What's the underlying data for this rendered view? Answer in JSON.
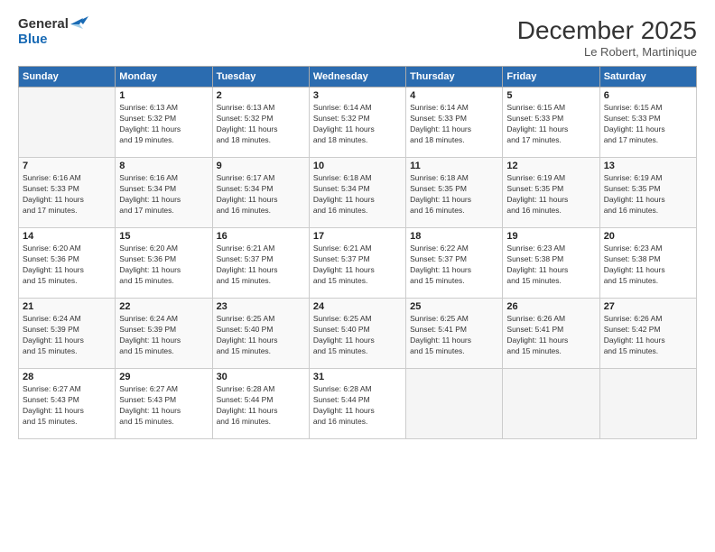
{
  "header": {
    "logo_line1": "General",
    "logo_line2": "Blue",
    "month_title": "December 2025",
    "subtitle": "Le Robert, Martinique"
  },
  "days_of_week": [
    "Sunday",
    "Monday",
    "Tuesday",
    "Wednesday",
    "Thursday",
    "Friday",
    "Saturday"
  ],
  "weeks": [
    [
      {
        "day": "",
        "info": ""
      },
      {
        "day": "1",
        "info": "Sunrise: 6:13 AM\nSunset: 5:32 PM\nDaylight: 11 hours\nand 19 minutes."
      },
      {
        "day": "2",
        "info": "Sunrise: 6:13 AM\nSunset: 5:32 PM\nDaylight: 11 hours\nand 18 minutes."
      },
      {
        "day": "3",
        "info": "Sunrise: 6:14 AM\nSunset: 5:32 PM\nDaylight: 11 hours\nand 18 minutes."
      },
      {
        "day": "4",
        "info": "Sunrise: 6:14 AM\nSunset: 5:33 PM\nDaylight: 11 hours\nand 18 minutes."
      },
      {
        "day": "5",
        "info": "Sunrise: 6:15 AM\nSunset: 5:33 PM\nDaylight: 11 hours\nand 17 minutes."
      },
      {
        "day": "6",
        "info": "Sunrise: 6:15 AM\nSunset: 5:33 PM\nDaylight: 11 hours\nand 17 minutes."
      }
    ],
    [
      {
        "day": "7",
        "info": "Sunrise: 6:16 AM\nSunset: 5:33 PM\nDaylight: 11 hours\nand 17 minutes."
      },
      {
        "day": "8",
        "info": "Sunrise: 6:16 AM\nSunset: 5:34 PM\nDaylight: 11 hours\nand 17 minutes."
      },
      {
        "day": "9",
        "info": "Sunrise: 6:17 AM\nSunset: 5:34 PM\nDaylight: 11 hours\nand 16 minutes."
      },
      {
        "day": "10",
        "info": "Sunrise: 6:18 AM\nSunset: 5:34 PM\nDaylight: 11 hours\nand 16 minutes."
      },
      {
        "day": "11",
        "info": "Sunrise: 6:18 AM\nSunset: 5:35 PM\nDaylight: 11 hours\nand 16 minutes."
      },
      {
        "day": "12",
        "info": "Sunrise: 6:19 AM\nSunset: 5:35 PM\nDaylight: 11 hours\nand 16 minutes."
      },
      {
        "day": "13",
        "info": "Sunrise: 6:19 AM\nSunset: 5:35 PM\nDaylight: 11 hours\nand 16 minutes."
      }
    ],
    [
      {
        "day": "14",
        "info": "Sunrise: 6:20 AM\nSunset: 5:36 PM\nDaylight: 11 hours\nand 15 minutes."
      },
      {
        "day": "15",
        "info": "Sunrise: 6:20 AM\nSunset: 5:36 PM\nDaylight: 11 hours\nand 15 minutes."
      },
      {
        "day": "16",
        "info": "Sunrise: 6:21 AM\nSunset: 5:37 PM\nDaylight: 11 hours\nand 15 minutes."
      },
      {
        "day": "17",
        "info": "Sunrise: 6:21 AM\nSunset: 5:37 PM\nDaylight: 11 hours\nand 15 minutes."
      },
      {
        "day": "18",
        "info": "Sunrise: 6:22 AM\nSunset: 5:37 PM\nDaylight: 11 hours\nand 15 minutes."
      },
      {
        "day": "19",
        "info": "Sunrise: 6:23 AM\nSunset: 5:38 PM\nDaylight: 11 hours\nand 15 minutes."
      },
      {
        "day": "20",
        "info": "Sunrise: 6:23 AM\nSunset: 5:38 PM\nDaylight: 11 hours\nand 15 minutes."
      }
    ],
    [
      {
        "day": "21",
        "info": "Sunrise: 6:24 AM\nSunset: 5:39 PM\nDaylight: 11 hours\nand 15 minutes."
      },
      {
        "day": "22",
        "info": "Sunrise: 6:24 AM\nSunset: 5:39 PM\nDaylight: 11 hours\nand 15 minutes."
      },
      {
        "day": "23",
        "info": "Sunrise: 6:25 AM\nSunset: 5:40 PM\nDaylight: 11 hours\nand 15 minutes."
      },
      {
        "day": "24",
        "info": "Sunrise: 6:25 AM\nSunset: 5:40 PM\nDaylight: 11 hours\nand 15 minutes."
      },
      {
        "day": "25",
        "info": "Sunrise: 6:25 AM\nSunset: 5:41 PM\nDaylight: 11 hours\nand 15 minutes."
      },
      {
        "day": "26",
        "info": "Sunrise: 6:26 AM\nSunset: 5:41 PM\nDaylight: 11 hours\nand 15 minutes."
      },
      {
        "day": "27",
        "info": "Sunrise: 6:26 AM\nSunset: 5:42 PM\nDaylight: 11 hours\nand 15 minutes."
      }
    ],
    [
      {
        "day": "28",
        "info": "Sunrise: 6:27 AM\nSunset: 5:43 PM\nDaylight: 11 hours\nand 15 minutes."
      },
      {
        "day": "29",
        "info": "Sunrise: 6:27 AM\nSunset: 5:43 PM\nDaylight: 11 hours\nand 15 minutes."
      },
      {
        "day": "30",
        "info": "Sunrise: 6:28 AM\nSunset: 5:44 PM\nDaylight: 11 hours\nand 16 minutes."
      },
      {
        "day": "31",
        "info": "Sunrise: 6:28 AM\nSunset: 5:44 PM\nDaylight: 11 hours\nand 16 minutes."
      },
      {
        "day": "",
        "info": ""
      },
      {
        "day": "",
        "info": ""
      },
      {
        "day": "",
        "info": ""
      }
    ]
  ]
}
